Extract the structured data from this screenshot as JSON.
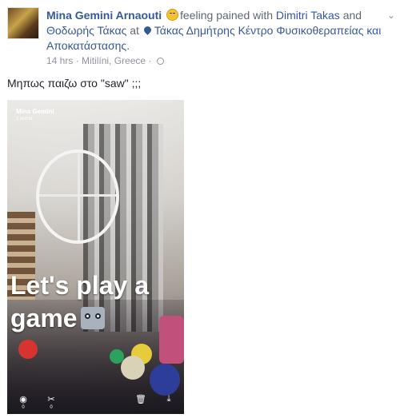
{
  "post": {
    "author": "Mina Gemini Arnaouti",
    "feeling_text": "feeling pained with",
    "tagged_1": "Dimitri Takas",
    "and": "and",
    "tagged_2": "Θοδωρής Τάκας",
    "at": "at",
    "place": "Τάκας Δημήτρης Κέντρο Φυσικοθεραπείας και Αποκατάστασης",
    "place_end": ".",
    "time": "14 hrs",
    "sep": "·",
    "location": "Mitilíni, Greece",
    "sep2": "·",
    "text": "Μηπως παιζω στο \"saw\" ;;;"
  },
  "icons": {
    "feeling": "pained-emoji-icon",
    "place": "map-pin-icon",
    "privacy": "globe-icon",
    "menu": "chevron-down-icon",
    "views": "eye-icon",
    "shares": "scissors-icon",
    "delete": "trash-icon",
    "download": "download-icon",
    "caption_emoji": "robot-face-icon"
  },
  "photo": {
    "overlay_name": "Mina Gemini",
    "overlay_time": "2 λεπτά",
    "caption": "Let's play a game",
    "views_count": "0",
    "shares_count": "0"
  },
  "colors": {
    "link": "#365899",
    "muted": "#90949c",
    "text": "#1d2129"
  }
}
